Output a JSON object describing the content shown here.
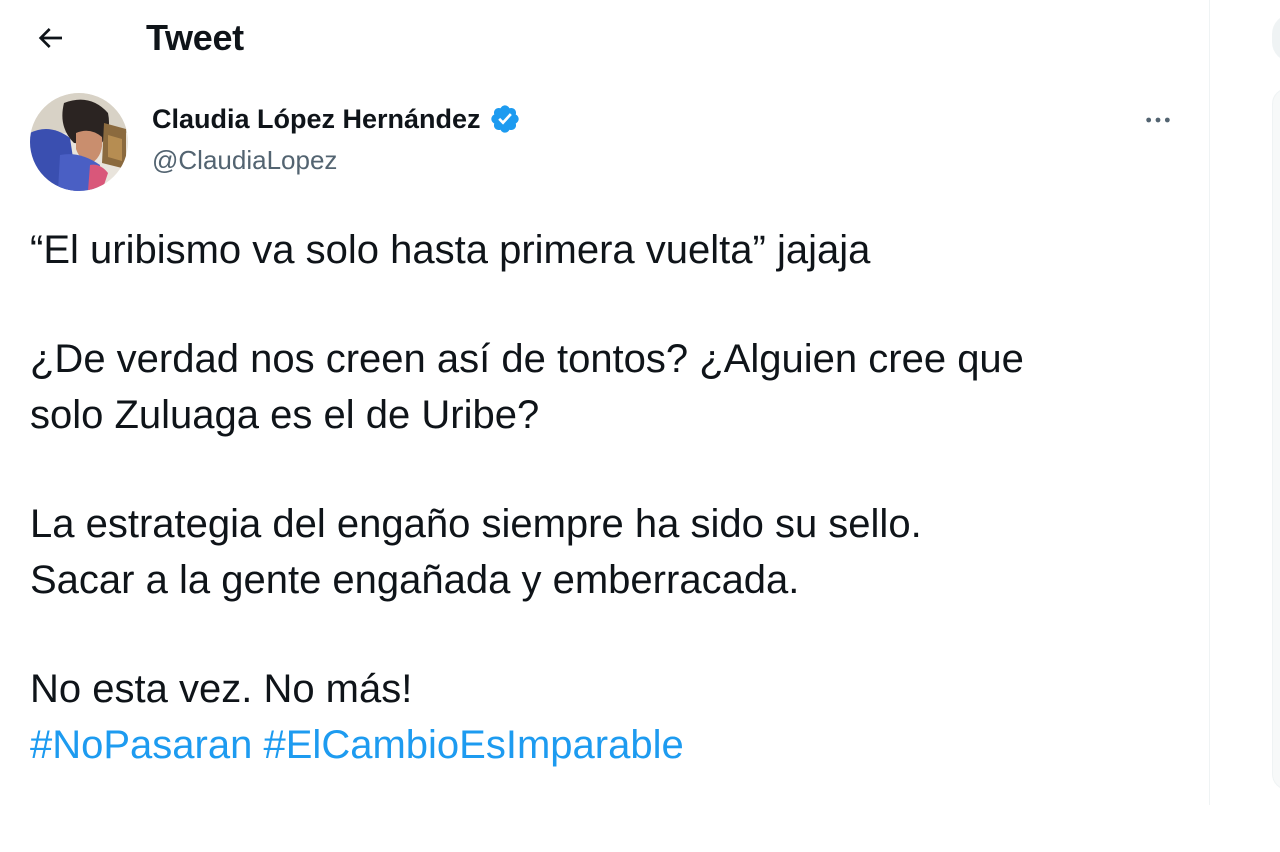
{
  "header": {
    "title": "Tweet",
    "back_icon": "arrow-left-icon"
  },
  "author": {
    "name": "Claudia López Hernández",
    "handle": "@ClaudiaLopez",
    "verified": true,
    "verified_color": "#1d9bf0"
  },
  "tweet": {
    "line1": "“El uribismo va solo hasta primera vuelta” jajaja",
    "line2": "¿De verdad nos creen así de tontos? ¿Alguien cree que",
    "line3": "solo Zuluaga es el de Uribe?",
    "line4": "La estrategia del engaño siempre ha sido su sello.",
    "line5": "Sacar a la gente engañada y emberracada.",
    "line6": "No esta vez. No más!",
    "hashtags": [
      "#NoPasaran",
      "#ElCambioEsImparable"
    ]
  },
  "colors": {
    "text": "#0f1419",
    "secondary": "#536471",
    "accent": "#1d9bf0"
  },
  "icons": {
    "more": "more-horizontal-icon",
    "verified": "verified-badge-icon"
  }
}
